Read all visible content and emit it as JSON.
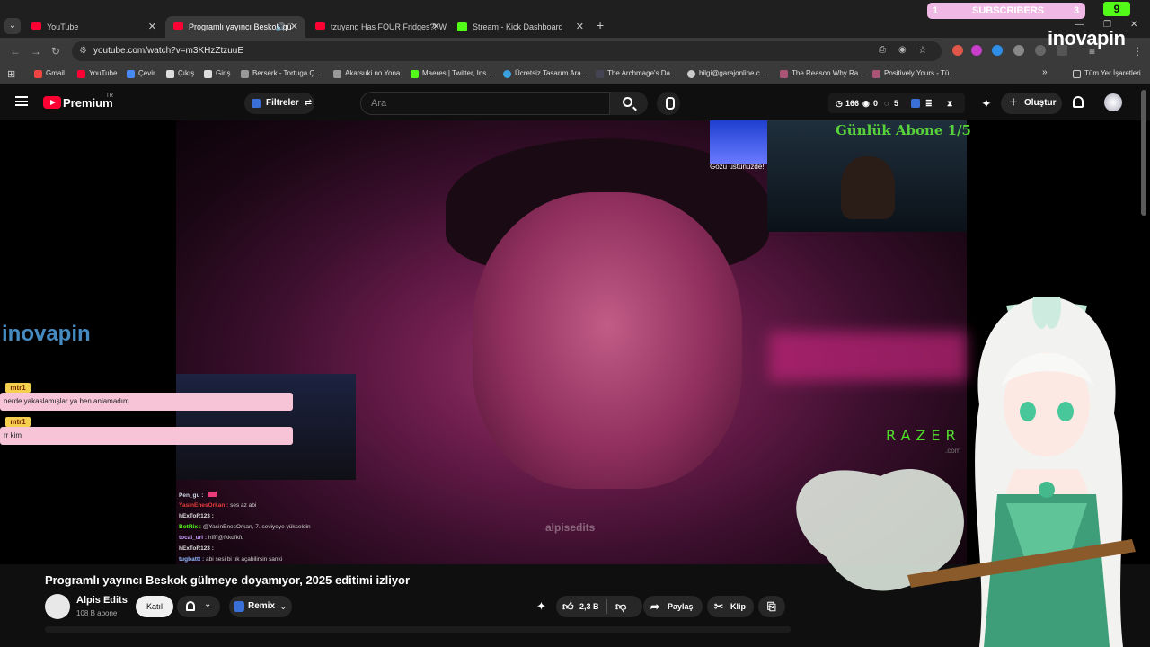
{
  "browser": {
    "tabs": [
      {
        "title": "YouTube",
        "active": false
      },
      {
        "title": "Programlı yayıncı Beskok gü",
        "active": true
      },
      {
        "title": "tzuyang Has FOUR Fridges?! W",
        "active": false
      },
      {
        "title": "Stream - Kick Dashboard",
        "active": false
      }
    ],
    "new_tab": "+",
    "url": "youtube.com/watch?v=m3KHzZtzuuE",
    "bookmarks": [
      "Gmail",
      "YouTube",
      "Çevir",
      "Çıkış",
      "Giriş",
      "Berserk - Tortuga Ç...",
      "Akatsuki no Yona",
      "Maeres | Twitter, Ins...",
      "Ücretsiz Tasarım Ara...",
      "The Archmage's Da...",
      "bilgi@garajonline.c...",
      "The Reason Why Ra...",
      "Positively Yours - Tü..."
    ],
    "bookmarks_more": "»",
    "all_bookmarks": "Tüm Yer İşaretleri"
  },
  "overlay": {
    "subs_left": "1",
    "subs_label": "SUBSCRIBERS",
    "subs_right": "3",
    "kick_count": "9",
    "inovapin": "inovapin",
    "gunluk_abone": "Günlük Abone 1/5",
    "gozu": "Gözü üstünüzde!",
    "razer": "RAZER",
    "razer_com": ".com",
    "video_watermark": "alpisedits",
    "chat_messages": [
      {
        "user": "mtr1",
        "text": "nerde yakaslamışlar ya ben anlamadım"
      },
      {
        "user": "mtr1",
        "text": "rr kim"
      }
    ],
    "chat_lines": [
      {
        "user": "Pen_gu :",
        "text": ""
      },
      {
        "user": "YasinEnesOrkan :",
        "text": "ses az abi"
      },
      {
        "user": "hExToR123 :",
        "text": ""
      },
      {
        "user": "BotRix :",
        "text": "@YasinEnesOrkan, 7. seviyeye yükseldin"
      },
      {
        "user": "tocal_url :",
        "text": "hffff@fkkdfkfd"
      },
      {
        "user": "hExToR123 :",
        "text": ""
      },
      {
        "user": "tugbattt :",
        "text": "abi sesi bi tık açabilirsin sanki"
      }
    ]
  },
  "youtube": {
    "logo_text": "Premium",
    "region": "TR",
    "filters": "Filtreler",
    "search_placeholder": "Ara",
    "stats": {
      "a": "166",
      "b": "0",
      "c": "5"
    },
    "create": "Oluştur",
    "video_title": "Programlı yayıncı Beskok gülmeye doyamıyor, 2025 editimi izliyor",
    "channel": "Alpis Edits",
    "subscribers": "108 B abone",
    "join": "Katıl",
    "remix": "Remix",
    "likes": "2,3 B",
    "share": "Paylaş",
    "clip": "Klip"
  },
  "colors": {
    "accent": "#ff0033",
    "kick": "#53fc18",
    "overlay_green": "#58d23a",
    "chat_bg": "#f6c4d6"
  }
}
